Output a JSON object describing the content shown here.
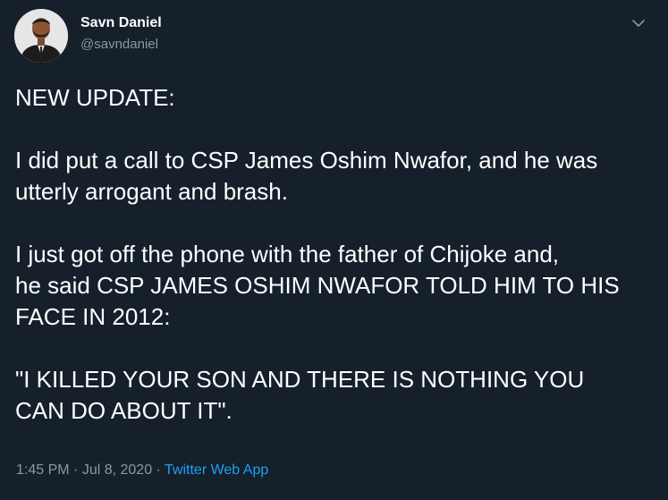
{
  "author": {
    "name": "Savn Daniel",
    "handle": "@savndaniel"
  },
  "tweet": {
    "paragraphs": [
      "NEW UPDATE:",
      "I did put a call to CSP James Oshim Nwafor, and he was\nutterly arrogant and brash.",
      "I just got off the phone with the father of Chijoke and,\nhe said CSP JAMES OSHIM NWAFOR TOLD HIM TO HIS\nFACE IN 2012:",
      "\"I KILLED YOUR SON AND THERE IS NOTHING YOU\nCAN DO ABOUT IT\"."
    ]
  },
  "meta": {
    "time": "1:45 PM",
    "separator1": " · ",
    "date": "Jul 8, 2020",
    "separator2": " · ",
    "source": "Twitter Web App"
  },
  "icons": {
    "menu": "chevron-down-icon",
    "avatar": "avatar"
  },
  "colors": {
    "background": "#15202b",
    "text_primary": "#ffffff",
    "text_secondary": "#8899a6",
    "accent": "#1da1f2"
  }
}
